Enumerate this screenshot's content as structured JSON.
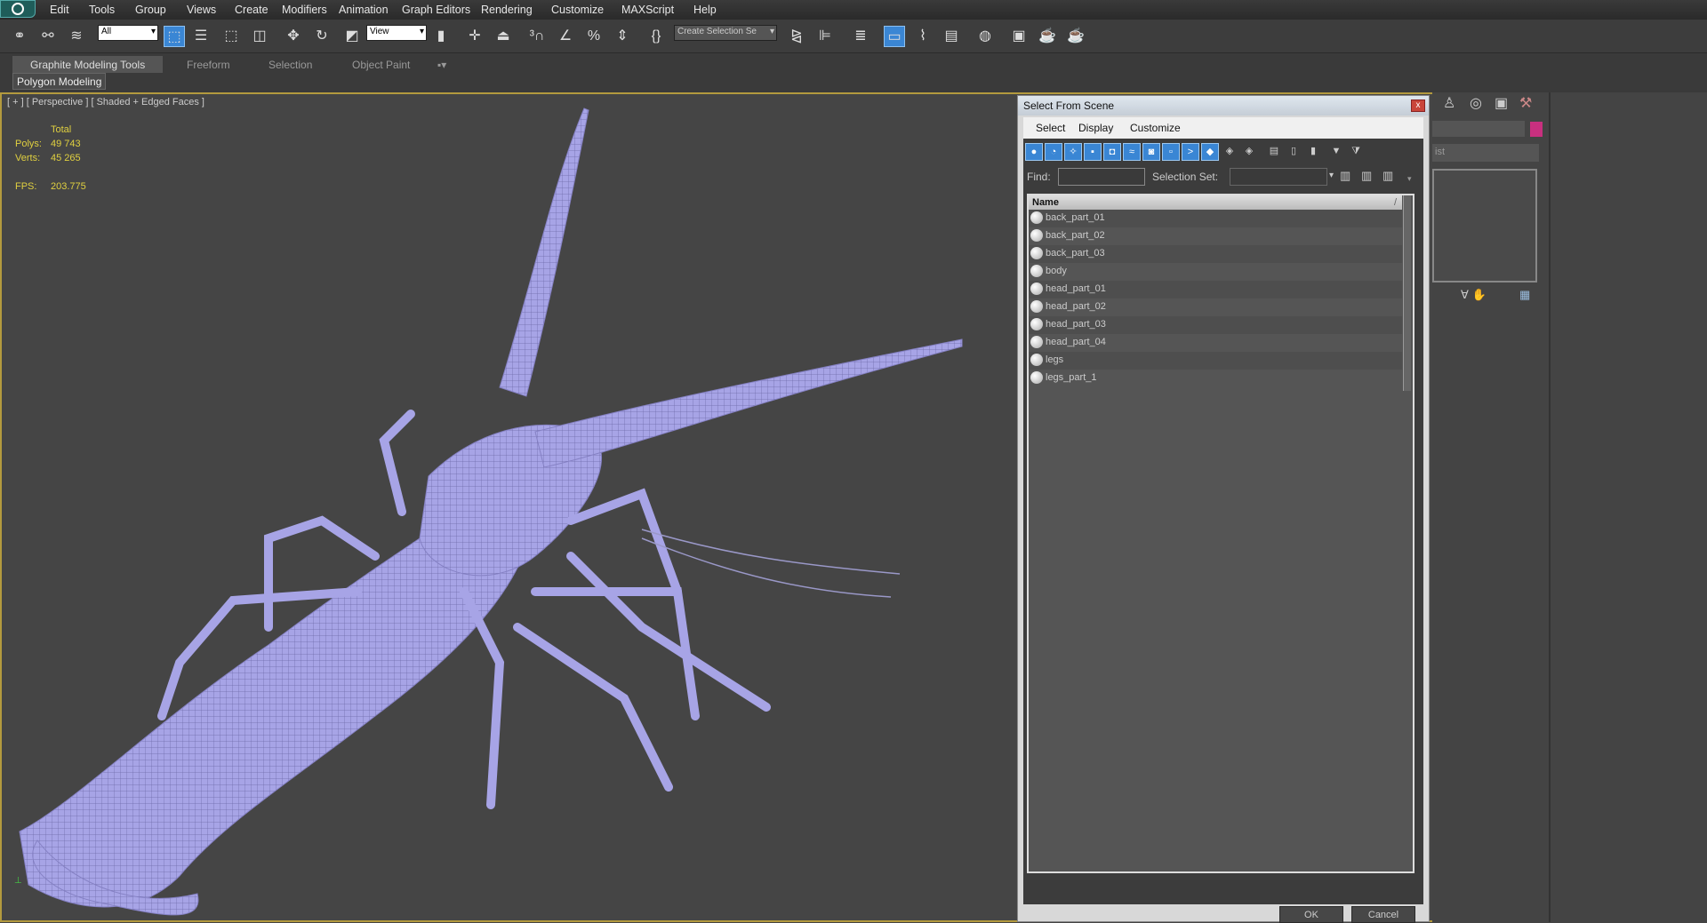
{
  "menu": [
    "Edit",
    "Tools",
    "Group",
    "Views",
    "Create",
    "Modifiers",
    "Animation",
    "Graph Editors",
    "Rendering",
    "Customize",
    "MAXScript",
    "Help"
  ],
  "toolbar": {
    "filter_value": "All",
    "ref_coord_value": "View",
    "selection_set_placeholder": "Create Selection Se"
  },
  "ribbon": {
    "tabs": [
      "Graphite Modeling Tools",
      "Freeform",
      "Selection",
      "Object Paint"
    ],
    "subtab": "Polygon Modeling"
  },
  "viewport": {
    "label": "[ + ] [ Perspective ] [ Shaded + Edged Faces ]",
    "stats": {
      "total_label": "Total",
      "polys_label": "Polys:",
      "polys": "49 743",
      "verts_label": "Verts:",
      "verts": "45 265",
      "fps_label": "FPS:",
      "fps": "203.775"
    }
  },
  "dialog": {
    "title": "Select From Scene",
    "close": "x",
    "menu": [
      "Select",
      "Display",
      "Customize"
    ],
    "find_label": "Find:",
    "find_value": "",
    "selection_set_label": "Selection Set:",
    "column_name": "Name",
    "sort_glyph": "/",
    "items": [
      "back_part_01",
      "back_part_02",
      "back_part_03",
      "body",
      "head_part_01",
      "head_part_02",
      "head_part_03",
      "head_part_04",
      "legs",
      "legs_part_1"
    ],
    "ok": "OK",
    "cancel": "Cancel"
  },
  "command_panel": {
    "list_placeholder": "ist"
  },
  "colors": {
    "accent": "#3a86d4",
    "mesh": "#a7a4e6",
    "viewport_border": "#b39a3e",
    "swatch": "#c8307f"
  }
}
